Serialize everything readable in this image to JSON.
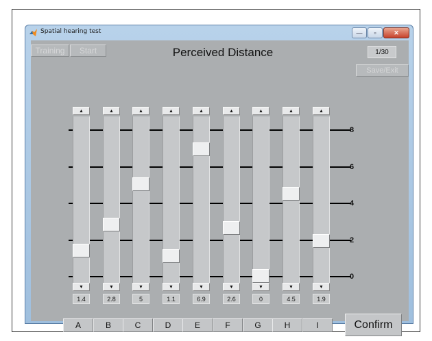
{
  "window": {
    "title": "Spatial hearing test",
    "minimize_glyph": "—",
    "maximize_glyph": "▫",
    "close_glyph": "✕"
  },
  "toolbar": {
    "training_label": "Training",
    "start_label": "Start",
    "save_exit_label": "Save/Exit"
  },
  "heading": "Perceived Distance",
  "counter": "1/30",
  "scale": {
    "ticks": [
      "8",
      "6",
      "4",
      "2",
      "0"
    ],
    "min": 0,
    "max": 9
  },
  "arrows": {
    "up": "▲",
    "down": "▼"
  },
  "sliders": [
    {
      "letter": "A",
      "value": 1.4,
      "label": "1.4"
    },
    {
      "letter": "B",
      "value": 2.8,
      "label": "2.8"
    },
    {
      "letter": "C",
      "value": 5,
      "label": "5"
    },
    {
      "letter": "D",
      "value": 1.1,
      "label": "1.1"
    },
    {
      "letter": "E",
      "value": 6.9,
      "label": "6.9"
    },
    {
      "letter": "F",
      "value": 2.6,
      "label": "2.6"
    },
    {
      "letter": "G",
      "value": 0,
      "label": "0"
    },
    {
      "letter": "H",
      "value": 4.5,
      "label": "4.5"
    },
    {
      "letter": "I",
      "value": 1.9,
      "label": "1.9"
    }
  ],
  "confirm_label": "Confirm",
  "colors": {
    "client_bg": "#abaeb0",
    "title_gradient_top": "#b8d2ea",
    "close_red": "#c7432c",
    "icon_orange": "#f08a1e"
  },
  "icons": {
    "app": "matlab-logo-icon"
  }
}
